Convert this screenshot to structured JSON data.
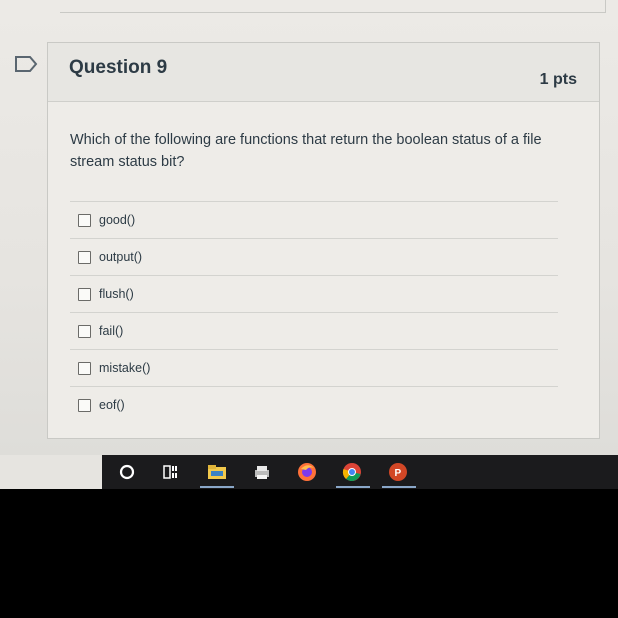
{
  "question": {
    "title": "Question 9",
    "points": "1 pts",
    "text": "Which of the following are functions that return the boolean status of a file stream status bit?"
  },
  "answers": [
    {
      "label": "good()"
    },
    {
      "label": "output()"
    },
    {
      "label": "flush()"
    },
    {
      "label": "fail()"
    },
    {
      "label": "mistake()"
    },
    {
      "label": "eof()"
    }
  ],
  "taskbar": {
    "icons": [
      "search-circle-icon",
      "task-view-icon",
      "file-explorer-icon",
      "printer-icon",
      "firefox-icon",
      "chrome-icon",
      "powerpoint-icon"
    ]
  },
  "colors": {
    "text": "#2d3b45",
    "taskbar": "#1b1b1d",
    "firefox": "#ff7139",
    "chrome_red": "#db4437",
    "powerpoint": "#d24726"
  }
}
